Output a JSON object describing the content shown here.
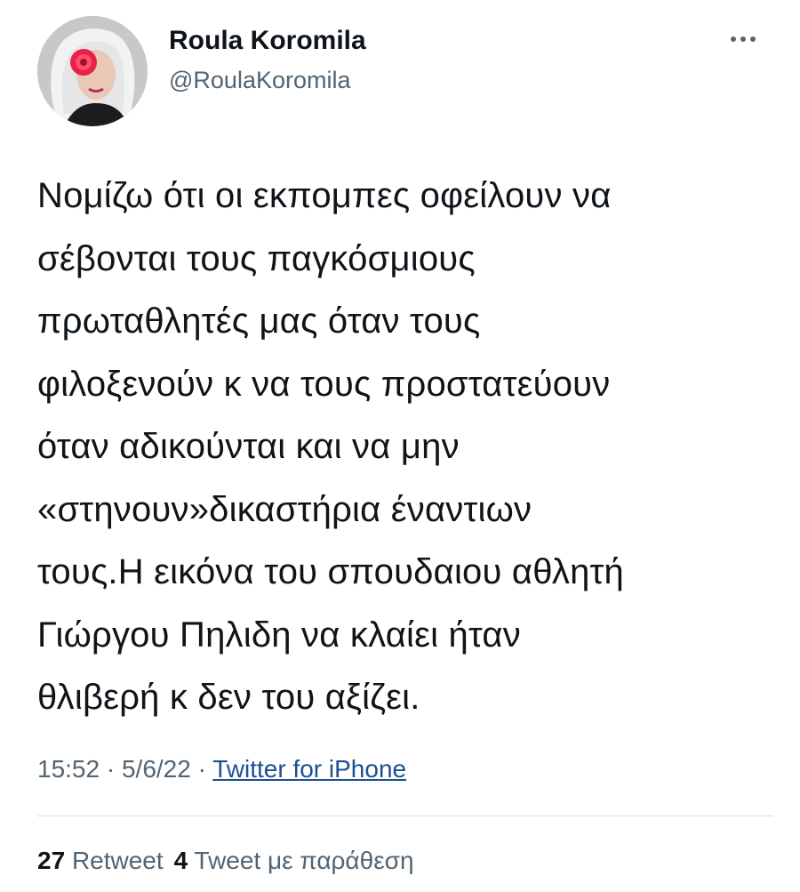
{
  "author": {
    "display_name": "Roula Koromila",
    "handle": "@RoulaKoromila"
  },
  "more_icon": "more-horizontal-icon",
  "tweet": {
    "lines": [
      "Νομίζω ότι οι εκπομπες οφείλουν να",
      "σέβονται τους παγκόσμιους",
      "πρωταθλητές μας όταν τους",
      "φιλοξενούν κ να τους προστατεύουν",
      "όταν αδικούνται και να μην",
      "«στηνουν»δικαστήρια έναντιων",
      "τους.Η εικόνα του σπουδαιου αθλητή",
      "Γιώργου Πηλιδη να κλαίει ήταν",
      "θλιβερή κ δεν του αξίζει."
    ]
  },
  "meta": {
    "time": "15:52",
    "separator1": " · ",
    "date": "5/6/22",
    "separator2": " · ",
    "source": "Twitter for iPhone"
  },
  "stats": {
    "retweets_count": "27",
    "retweets_label": "Retweet",
    "quotes_count": "4",
    "quotes_label": "Tweet με παράθεση"
  },
  "colors": {
    "text": "#0f1419",
    "secondary": "#536471",
    "link": "#1d4f91"
  }
}
